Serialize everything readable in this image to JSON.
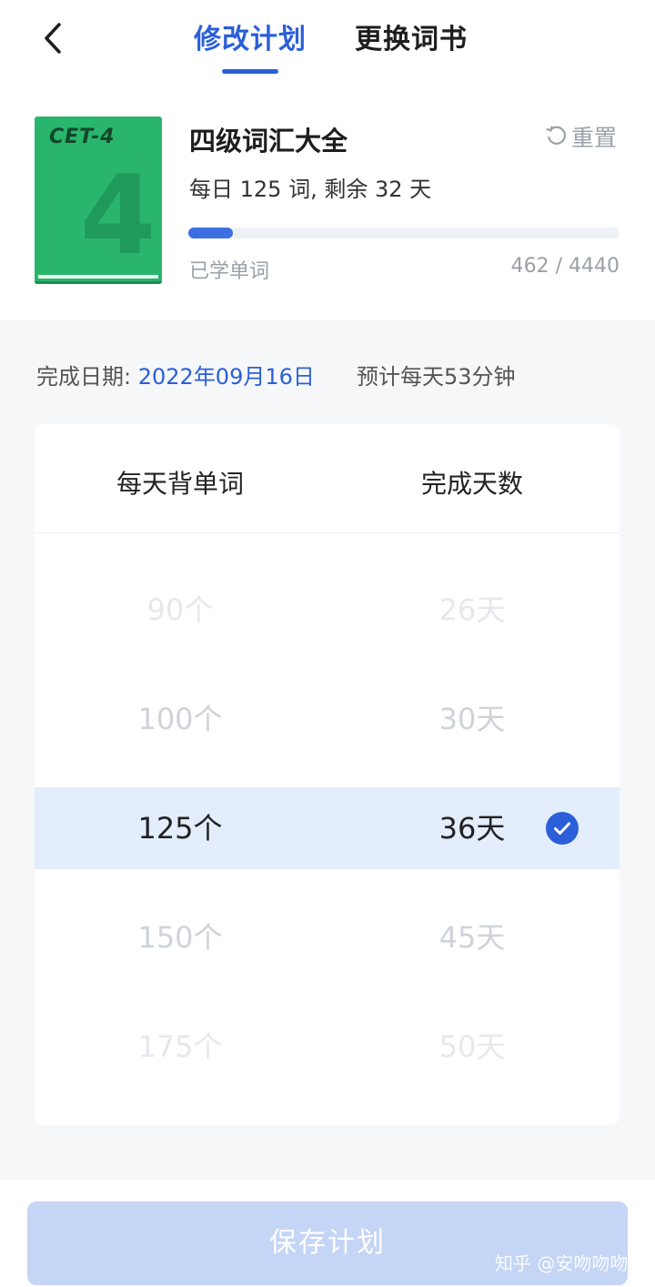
{
  "header": {
    "tab_active": "修改计划",
    "tab_inactive": "更换词书"
  },
  "book": {
    "cover_label": "CET-4",
    "cover_number": "4",
    "cover_color": "#2ab56c",
    "title": "四级词汇大全",
    "reset_label": "重置",
    "plan_summary": "每日 125 词, 剩余 32 天",
    "progress_fraction": 0.104,
    "learned_label": "已学单词",
    "learned_count": "462 / 4440"
  },
  "plan": {
    "date_label": "完成日期:",
    "date_value": "2022年09月16日",
    "estimate": "预计每天53分钟"
  },
  "picker": {
    "col_words": "每天背单词",
    "col_days": "完成天数",
    "rows": [
      {
        "words": "90个",
        "days": "26天"
      },
      {
        "words": "100个",
        "days": "30天"
      },
      {
        "words": "125个",
        "days": "36天"
      },
      {
        "words": "150个",
        "days": "45天"
      },
      {
        "words": "175个",
        "days": "50天"
      }
    ],
    "selected_index": 2
  },
  "footer": {
    "save_label": "保存计划",
    "watermark": "知乎 @安吻吻吻"
  },
  "colors": {
    "accent": "#2b5fd9",
    "selected_row": "#e3edfb",
    "save_button_disabled": "#c5d5f5"
  }
}
